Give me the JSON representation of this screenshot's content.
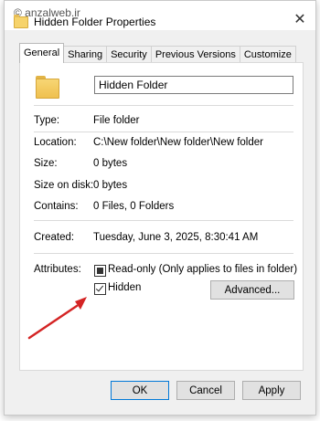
{
  "watermark": "© anzalweb.ir",
  "window": {
    "title": "Hidden Folder Properties",
    "close_glyph": "✕"
  },
  "tabs": [
    {
      "label": "General",
      "active": true
    },
    {
      "label": "Sharing"
    },
    {
      "label": "Security"
    },
    {
      "label": "Previous Versions"
    },
    {
      "label": "Customize"
    }
  ],
  "general": {
    "folder_name": "Hidden Folder",
    "type_label": "Type:",
    "type_value": "File folder",
    "location_label": "Location:",
    "location_value": "C:\\New folder\\New folder\\New folder",
    "size_label": "Size:",
    "size_value": "0 bytes",
    "size_on_disk_label": "Size on disk:",
    "size_on_disk_value": "0 bytes",
    "contains_label": "Contains:",
    "contains_value": "0 Files, 0 Folders",
    "created_label": "Created:",
    "created_value": "Tuesday, June 3, 2025, 8:30:41 AM",
    "attributes_label": "Attributes:",
    "readonly_label": "Read-only (Only applies to files in folder)",
    "readonly_state": "indeterminate",
    "hidden_label": "Hidden",
    "hidden_checked": true,
    "advanced_button": "Advanced..."
  },
  "footer": {
    "ok": "OK",
    "cancel": "Cancel",
    "apply": "Apply"
  },
  "colors": {
    "annotation_arrow": "#d42424",
    "default_button_border": "#0078d7"
  }
}
